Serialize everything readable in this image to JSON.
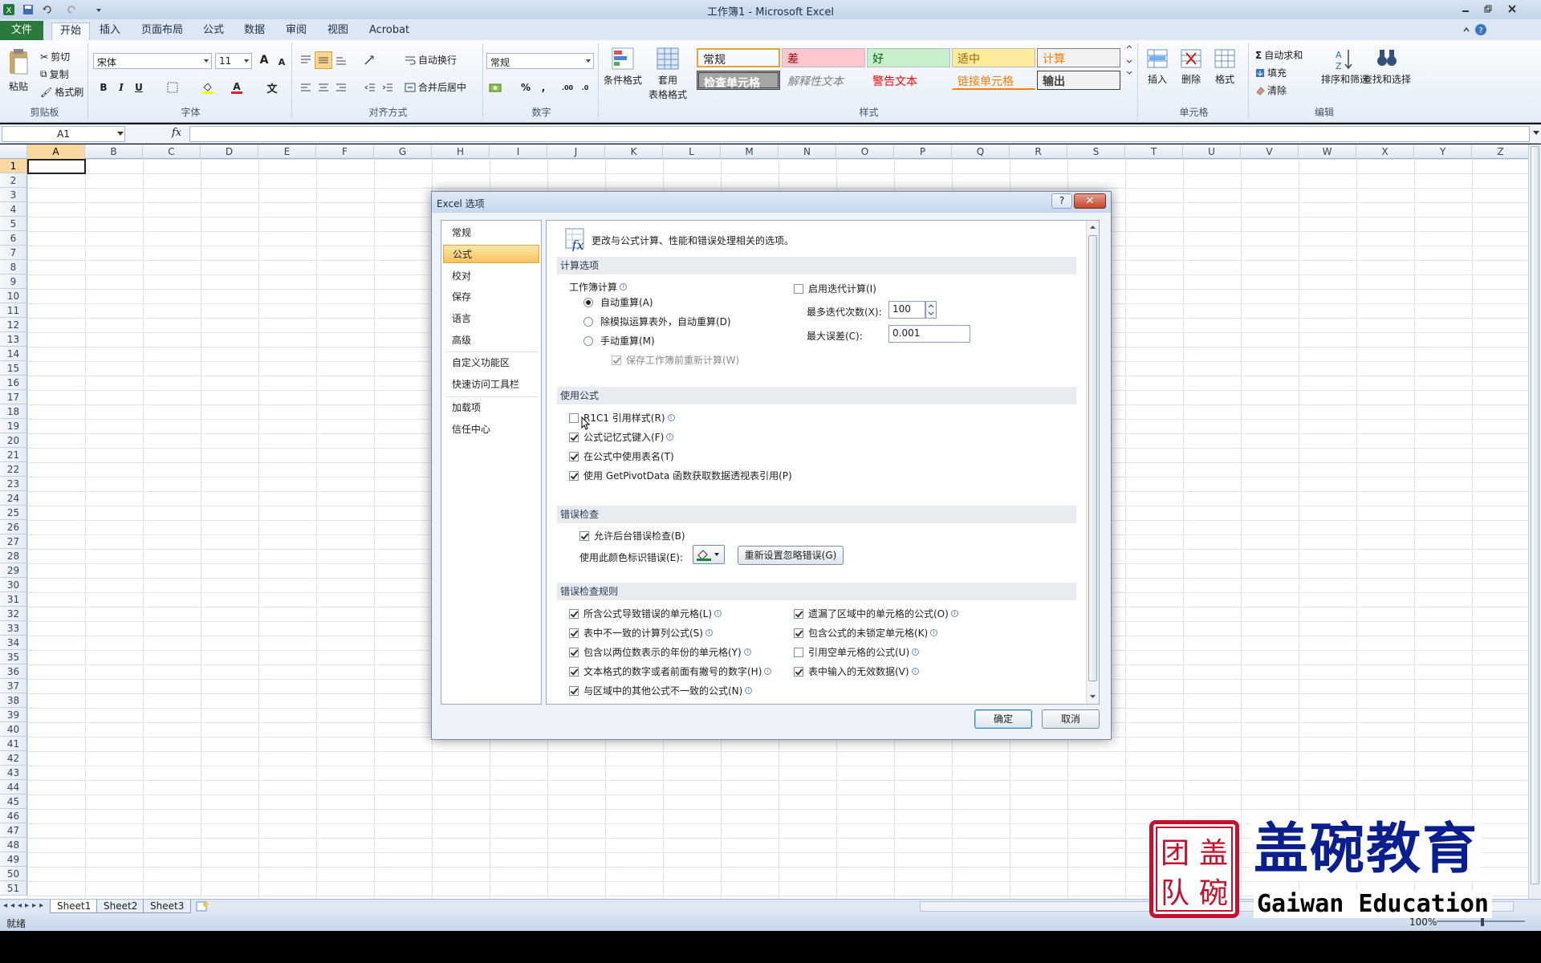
{
  "window": {
    "title": "工作簿1 - Microsoft Excel",
    "app_icon": "excel-icon"
  },
  "ribbon_tabs": [
    {
      "label": "文件"
    },
    {
      "label": "开始"
    },
    {
      "label": "插入"
    },
    {
      "label": "页面布局"
    },
    {
      "label": "公式"
    },
    {
      "label": "数据"
    },
    {
      "label": "审阅"
    },
    {
      "label": "视图"
    },
    {
      "label": "Acrobat"
    }
  ],
  "ribbon": {
    "clipboard": {
      "paste": "粘贴",
      "cut": "剪切",
      "copy": "复制",
      "format_painter": "格式刷",
      "label": "剪贴板"
    },
    "font": {
      "name": "宋体",
      "size": "11",
      "label": "字体",
      "bold": "B",
      "italic": "I",
      "underline": "U",
      "grow": "A",
      "shrink": "A",
      "phonetic": "文"
    },
    "alignment": {
      "wrap": "自动换行",
      "merge": "合并后居中",
      "label": "对齐方式"
    },
    "number": {
      "format": "常规",
      "percent": "%",
      "comma": ",",
      "label": "数字"
    },
    "styles": {
      "cond_format": "条件格式",
      "table_format_1": "套用",
      "table_format_2": "表格格式",
      "cells": [
        {
          "text": "常规",
          "bg": "#ffffff",
          "fg": "#000000"
        },
        {
          "text": "差",
          "bg": "#ffc7ce",
          "fg": "#9c0006"
        },
        {
          "text": "好",
          "bg": "#c6efce",
          "fg": "#006100"
        },
        {
          "text": "适中",
          "bg": "#ffeb9c",
          "fg": "#9c6500"
        },
        {
          "text": "计算",
          "bg": "#f2f2f2",
          "fg": "#fa7d00"
        },
        {
          "text": "检查单元格",
          "bg": "#a5a5a5",
          "fg": "#ffffff"
        },
        {
          "text": "解释性文本",
          "bg": "#ffffff",
          "fg": "#7f7f7f"
        },
        {
          "text": "警告文本",
          "bg": "#ffffff",
          "fg": "#ff0000"
        },
        {
          "text": "链接单元格",
          "bg": "#ffffff",
          "fg": "#fa7d00"
        },
        {
          "text": "输出",
          "bg": "#f2f2f2",
          "fg": "#3f3f3f"
        }
      ],
      "label": "样式"
    },
    "cells": {
      "insert": "插入",
      "delete": "删除",
      "format": "格式",
      "label": "单元格"
    },
    "editing": {
      "autosum": "自动求和",
      "fill": "填充",
      "clear": "清除",
      "sort": "排序和筛选",
      "find": "查找和选择",
      "label": "编辑"
    }
  },
  "formula_bar": {
    "name_box": "A1",
    "fx": "fx",
    "value": ""
  },
  "sheet": {
    "columns": [
      "A",
      "B",
      "C",
      "D",
      "E",
      "F",
      "G",
      "H",
      "I",
      "J",
      "K",
      "L",
      "M",
      "N",
      "O",
      "P",
      "Q",
      "R",
      "S",
      "T",
      "U",
      "V",
      "W",
      "X",
      "Y",
      "Z"
    ],
    "rows": [
      "1",
      "2",
      "3",
      "4",
      "5",
      "6",
      "7",
      "8",
      "9",
      "10",
      "11",
      "12",
      "13",
      "14",
      "15",
      "16",
      "17",
      "18",
      "19",
      "20",
      "21",
      "22",
      "23",
      "24",
      "25",
      "26",
      "27",
      "28",
      "29",
      "30",
      "31",
      "32",
      "33",
      "34",
      "35",
      "36",
      "37",
      "38",
      "39",
      "40",
      "41",
      "42",
      "43",
      "44",
      "45",
      "46",
      "47",
      "48",
      "49",
      "50",
      "51"
    ],
    "selected_cell": "A1",
    "tabs": [
      "Sheet1",
      "Sheet2",
      "Sheet3"
    ]
  },
  "status": {
    "ready": "就绪",
    "zoom": "100%"
  },
  "dialog": {
    "title": "Excel 选项",
    "help": "?",
    "close": "✕",
    "nav": [
      {
        "label": "常规"
      },
      {
        "label": "公式"
      },
      {
        "label": "校对"
      },
      {
        "label": "保存"
      },
      {
        "label": "语言"
      },
      {
        "label": "高级"
      },
      {
        "label": "自定义功能区"
      },
      {
        "label": "快速访问工具栏"
      },
      {
        "label": "加载项"
      },
      {
        "label": "信任中心"
      }
    ],
    "intro": "更改与公式计算、性能和错误处理相关的选项。",
    "calc": {
      "header": "计算选项",
      "workbook_calc": "工作簿计算",
      "auto": "自动重算(A)",
      "auto_except": "除模拟运算表外，自动重算(D)",
      "manual": "手动重算(M)",
      "recalc_save": "保存工作簿前重新计算(W)",
      "iterative": "启用迭代计算(I)",
      "max_iter_label": "最多迭代次数(X):",
      "max_iter": "100",
      "max_change_label": "最大误差(C):",
      "max_change": "0.001"
    },
    "formulas": {
      "header": "使用公式",
      "r1c1": "R1C1 引用样式(R)",
      "autocomplete": "公式记忆式键入(F)",
      "table_names": "在公式中使用表名(T)",
      "getpivot": "使用 GetPivotData 函数获取数据透视表引用(P)"
    },
    "errors": {
      "header": "错误检查",
      "background": "允许后台错误检查(B)",
      "color_label": "使用此颜色标识错误(E):",
      "reset": "重新设置忽略错误(G)"
    },
    "rules": {
      "header": "错误检查规则",
      "left": [
        {
          "label": "所含公式导致错误的单元格(L)",
          "checked": true
        },
        {
          "label": "表中不一致的计算列公式(S)",
          "checked": true
        },
        {
          "label": "包含以两位数表示的年份的单元格(Y)",
          "checked": true
        },
        {
          "label": "文本格式的数字或者前面有撇号的数字(H)",
          "checked": true
        },
        {
          "label": "与区域中的其他公式不一致的公式(N)",
          "checked": true
        }
      ],
      "right": [
        {
          "label": "遗漏了区域中的单元格的公式(O)",
          "checked": true
        },
        {
          "label": "包含公式的未锁定单元格(K)",
          "checked": true
        },
        {
          "label": "引用空单元格的公式(U)",
          "checked": false
        },
        {
          "label": "表中输入的无效数据(V)",
          "checked": true
        }
      ]
    },
    "ok": "确定",
    "cancel": "取消"
  },
  "watermark": {
    "seal": "盖碗团队",
    "cn": "盖碗教育",
    "en": "Gaiwan Education"
  },
  "colors": {
    "accent": "#2b7a3c",
    "nav_active": "#f7c35d",
    "seal": "#c8102e",
    "brand": "#0a1f8f"
  }
}
